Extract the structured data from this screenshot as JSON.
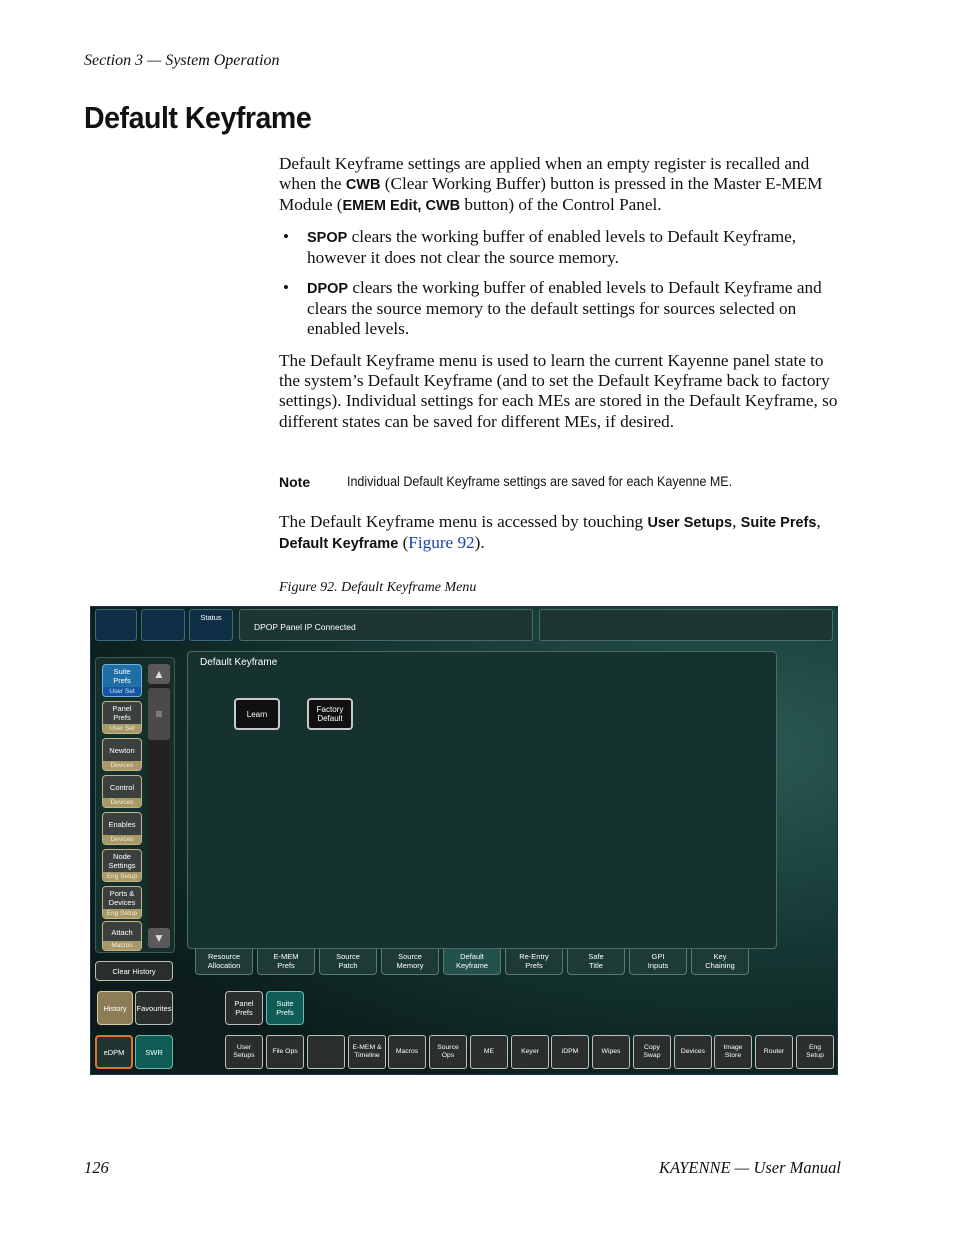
{
  "header": {
    "section": "Section 3 — System Operation"
  },
  "title": "Default Keyframe",
  "intro": {
    "p1_a": "Default Keyframe settings are applied when an empty register is recalled and when the ",
    "p1_cwb": "CWB",
    "p1_b": " (Clear Working Buffer) button is pressed in the Master E-MEM Module (",
    "p1_ememedit": "EMEM Edit",
    "p1_sep": ", ",
    "p1_cwb2": "CWB",
    "p1_c": " button) of the Control Panel."
  },
  "bullets": [
    {
      "mark": "•",
      "term": "SPOP",
      "text": " clears the working buffer of enabled levels to Default Keyframe, however it does not clear the source memory."
    },
    {
      "mark": "•",
      "term": "DPOP",
      "text": " clears the working buffer of enabled levels to Default Keyframe and clears the source memory to the default settings for sources selected on enabled levels."
    }
  ],
  "para2": "The Default Keyframe menu is used to learn the current Kayenne panel state to the system’s Default Keyframe (and to set the Default Keyframe back to factory settings). Individual settings for each MEs are stored in the Default Keyframe, so different states can be saved for different MEs, if desired.",
  "note": {
    "label": "Note",
    "text": "Individual Default Keyframe settings are saved for each Kayenne ME."
  },
  "para3": {
    "a": "The Default Keyframe menu is accessed by touching ",
    "b1": "User Setups",
    "s1": ", ",
    "b2": "Suite Prefs",
    "s2": ", ",
    "b3": "Default Keyframe",
    "c": " (",
    "link": "Figure 92",
    "d": ")."
  },
  "caption": "Figure 92.  Default Keyframe Menu",
  "screenshot": {
    "status_label": "Status",
    "status_msg": "DPOP Panel IP Connected",
    "panel_title": "Default Keyframe",
    "learn": "Learn",
    "factory_1": "Factory",
    "factory_2": "Default",
    "sidebar": [
      {
        "l1": "Suite",
        "l2": "Prefs",
        "sub": "User Set"
      },
      {
        "l1": "Panel",
        "l2": "Prefs",
        "sub": "User Set"
      },
      {
        "l1": "Newton",
        "l2": "",
        "sub": "Devices"
      },
      {
        "l1": "Control",
        "l2": "",
        "sub": "Devices"
      },
      {
        "l1": "Enables",
        "l2": "",
        "sub": "Devices"
      },
      {
        "l1": "Node",
        "l2": "Settings",
        "sub": "Eng  Setup"
      },
      {
        "l1": "Ports &",
        "l2": "Devices",
        "sub": "Eng  Setup"
      },
      {
        "l1": "Attach",
        "l2": "",
        "sub": "Macros"
      }
    ],
    "tabs": [
      {
        "l1": "Resource",
        "l2": "Allocation"
      },
      {
        "l1": "E-MEM",
        "l2": "Prefs"
      },
      {
        "l1": "Source",
        "l2": "Patch"
      },
      {
        "l1": "Source",
        "l2": "Memory"
      },
      {
        "l1": "Default",
        "l2": "Keyframe"
      },
      {
        "l1": "Re-Entry",
        "l2": "Prefs"
      },
      {
        "l1": "Safe",
        "l2": "Title"
      },
      {
        "l1": "GPI",
        "l2": "Inputs"
      },
      {
        "l1": "Key",
        "l2": "Chaining"
      }
    ],
    "clear_history": "Clear History",
    "history": "History",
    "favourites": "Favourites",
    "edpm": "eDPM",
    "swr": "SWR",
    "sub_panel_1": "Panel",
    "sub_panel_2": "Prefs",
    "sub_suite_1": "Suite",
    "sub_suite_2": "Prefs",
    "bottom": [
      {
        "l1": "User",
        "l2": "Setups"
      },
      {
        "l1": "File Ops",
        "l2": ""
      },
      {
        "l1": "",
        "l2": ""
      },
      {
        "l1": "E-MEM &",
        "l2": "Timeline"
      },
      {
        "l1": "Macros",
        "l2": ""
      },
      {
        "l1": "Source",
        "l2": "Ops"
      },
      {
        "l1": "ME",
        "l2": ""
      },
      {
        "l1": "Keyer",
        "l2": ""
      },
      {
        "l1": "iDPM",
        "l2": ""
      },
      {
        "l1": "Wipes",
        "l2": ""
      },
      {
        "l1": "Copy",
        "l2": "Swap"
      },
      {
        "l1": "Devices",
        "l2": ""
      },
      {
        "l1": "Image",
        "l2": "Store"
      },
      {
        "l1": "Router",
        "l2": ""
      },
      {
        "l1": "Eng",
        "l2": "Setup"
      }
    ]
  },
  "footer": {
    "page": "126",
    "manual": "KAYENNE  —  User Manual"
  }
}
